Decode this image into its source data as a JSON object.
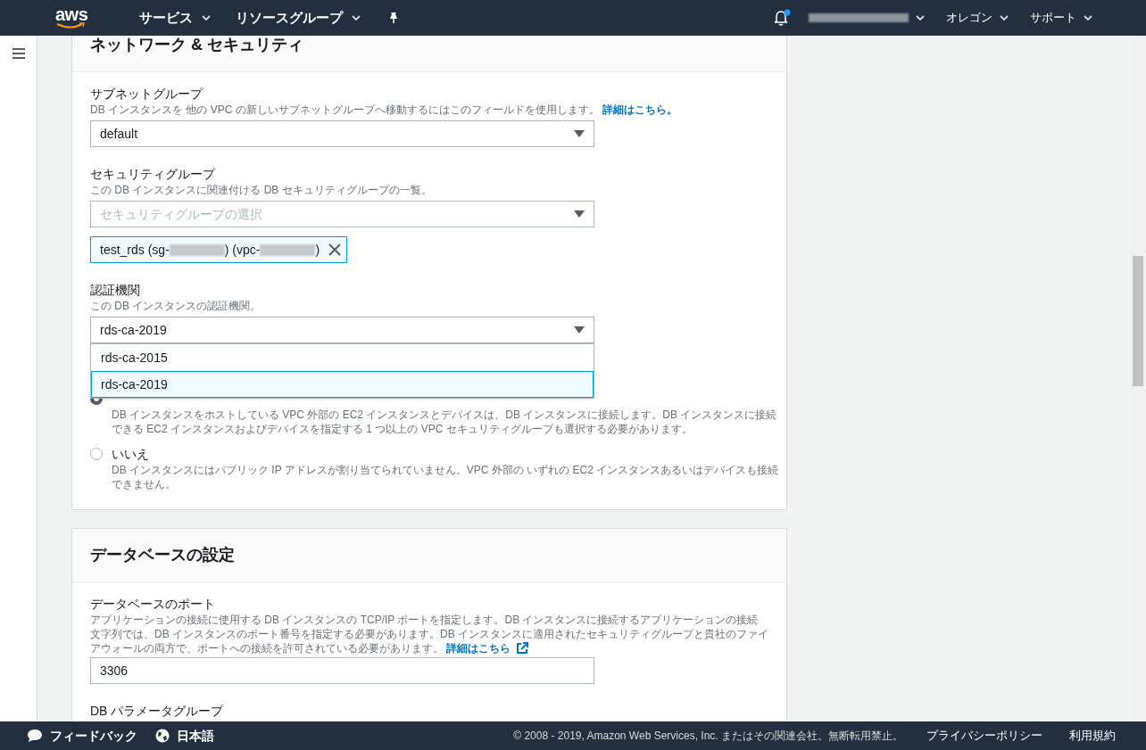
{
  "nav": {
    "logo": "aws",
    "menus": [
      {
        "label": "サービス"
      },
      {
        "label": "リソースグループ"
      }
    ],
    "notification": true,
    "region": "オレゴン",
    "support": "サポート"
  },
  "sections": [
    {
      "title": "ネットワーク & セキュリティ",
      "fields": [
        {
          "kind": "select",
          "label": "サブネットグループ",
          "description": "DB インスタンスを 他の VPC の新しいサブネットグループへ移動するにはこのフィールドを使用します。",
          "link": "詳細はこちら。",
          "value": "default"
        },
        {
          "kind": "select",
          "label": "セキュリティグループ",
          "description": "この DB インスタンスに関連付ける DB セキュリティグループの一覧。",
          "placeholder": "セキュリティグループの選択",
          "tags": [
            {
              "parts": [
                "test_rds (sg-",
                ") (vpc-",
                ")"
              ]
            }
          ]
        },
        {
          "kind": "select",
          "label": "認証機関",
          "description": "この DB インスタンスの認証機関。",
          "value": "rds-ca-2019",
          "expanded": true,
          "options": [
            {
              "label": "rds-ca-2015",
              "selected": false
            },
            {
              "label": "rds-ca-2019",
              "selected": true
            }
          ]
        },
        {
          "kind": "radio",
          "options": [
            {
              "description": "DB インスタンスをホストしている VPC 外部の EC2 インスタンスとデバイスは、DB インスタンスに接続します。DB インスタンスに接続できる EC2 インスタンスおよびデバイスを指定する 1 つ以上の VPC セキュリティグループも選択する必要があります。",
              "selected": true
            },
            {
              "label": "いいえ",
              "description": "DB インスタンスにはパブリック IP アドレスが割り当てられていません。VPC 外部の いずれの EC2 インスタンスあるいはデバイスも接続できません。",
              "selected": false
            }
          ]
        }
      ]
    },
    {
      "title": "データベースの設定",
      "fields": [
        {
          "kind": "text",
          "label": "データベースのポート",
          "description": "アプリケーションの接続に使用する DB インスタンスの TCP/IP ポートを指定します。DB インスタンスに接続するアプリケーションの接続文字列では、DB インスタンスのポート番号を指定する必要があります。DB インスタンスに適用されたセキュリティグループと貴社のファイアウォールの両方で、ポートへの接続を許可されている必要があります。",
          "link": "詳細はこちら",
          "external": true,
          "value": "3306"
        },
        {
          "kind": "label",
          "label": "DB パラメータグループ"
        }
      ]
    }
  ],
  "footer": {
    "feedback": "フィードバック",
    "language": "日本語",
    "copyright": "© 2008 - 2019, Amazon Web Services, Inc. またはその関連会社。無断転用禁止。",
    "links": [
      "プライバシーポリシー",
      "利用規約"
    ]
  }
}
